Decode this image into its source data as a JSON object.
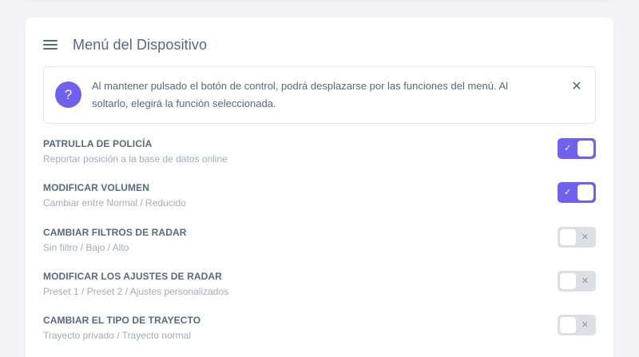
{
  "header": {
    "title": "Menú del Dispositivo",
    "menu_icon": "hamburger-icon"
  },
  "info": {
    "icon": "question-icon",
    "icon_glyph": "?",
    "text": "Al mantener pulsado el botón de control, podrá desplazarse por las funciones del menú. Al soltarlo, elegirá la función seleccionada.",
    "close_glyph": "✕"
  },
  "settings": [
    {
      "title": "PATRULLA DE POLICÍA",
      "subtitle": "Reportar posición a la base de datos online",
      "enabled": true,
      "mark": "✓"
    },
    {
      "title": "MODIFICAR VOLUMEN",
      "subtitle": "Cambiar entre Normal / Reducido",
      "enabled": true,
      "mark": "✓"
    },
    {
      "title": "CAMBIAR FILTROS DE RADAR",
      "subtitle": "Sin filtro / Bajo / Alto",
      "enabled": false,
      "mark": "✕"
    },
    {
      "title": "MODIFICAR LOS AJUSTES DE RADAR",
      "subtitle": "Preset 1 / Preset 2 / Ajustes personalizados",
      "enabled": false,
      "mark": "✕"
    },
    {
      "title": "CAMBIAR EL TIPO DE TRAYECTO",
      "subtitle": "Trayecto privado / Trayecto normal",
      "enabled": false,
      "mark": "✕"
    }
  ],
  "colors": {
    "accent": "#6e62ec",
    "text": "#566a7f",
    "muted": "#a1acb8",
    "toggle_off": "#dcdfe4"
  }
}
